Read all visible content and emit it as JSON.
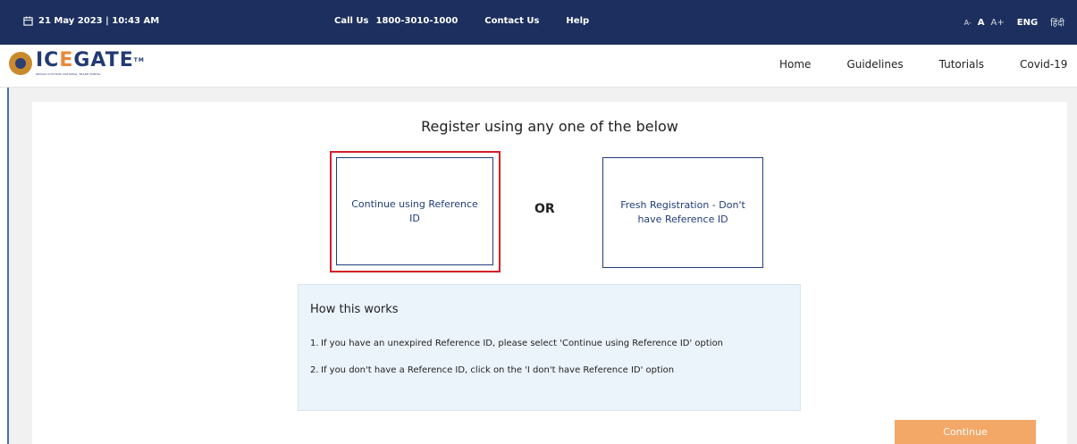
{
  "topbar": {
    "date_time": "21 May 2023 | 10:43 AM",
    "call_label": "Call Us",
    "call_number": "1800-3010-1000",
    "contact": "Contact Us",
    "help": "Help",
    "font_small": "A-",
    "font_normal": "A",
    "font_large": "A+",
    "lang_eng": "ENG",
    "lang_hindi": "हिंदी"
  },
  "logo": {
    "prefix": "IC",
    "letter_e": "E",
    "suffix": "GATE",
    "trademark": "TM",
    "tagline": "INDIAN CUSTOMS NATIONAL TRADE PORTAL"
  },
  "nav": {
    "items": [
      {
        "label": "Home"
      },
      {
        "label": "Guidelines"
      },
      {
        "label": "Tutorials"
      },
      {
        "label": "Covid-19"
      }
    ]
  },
  "main": {
    "heading": "Register using any one of the below",
    "option_reference": "Continue using Reference ID",
    "or_label": "OR",
    "option_fresh": "Fresh Registration - Don't have Reference ID",
    "how_title": "How this works",
    "steps": [
      {
        "num": "1.",
        "text": "If you have an unexpired Reference ID, please select 'Continue using Reference ID' option"
      },
      {
        "num": "2.",
        "text": "If you don't have a Reference ID, click on the 'I don't have Reference ID' option"
      }
    ],
    "continue_label": "Continue"
  },
  "colors": {
    "topbar_bg": "#1c2f5e",
    "accent_blue": "#203c7a",
    "selected_border": "#d32027",
    "continue_bg": "#f3a868",
    "info_bg": "#ebf3fb"
  },
  "icons": {
    "calendar": "calendar-icon"
  }
}
